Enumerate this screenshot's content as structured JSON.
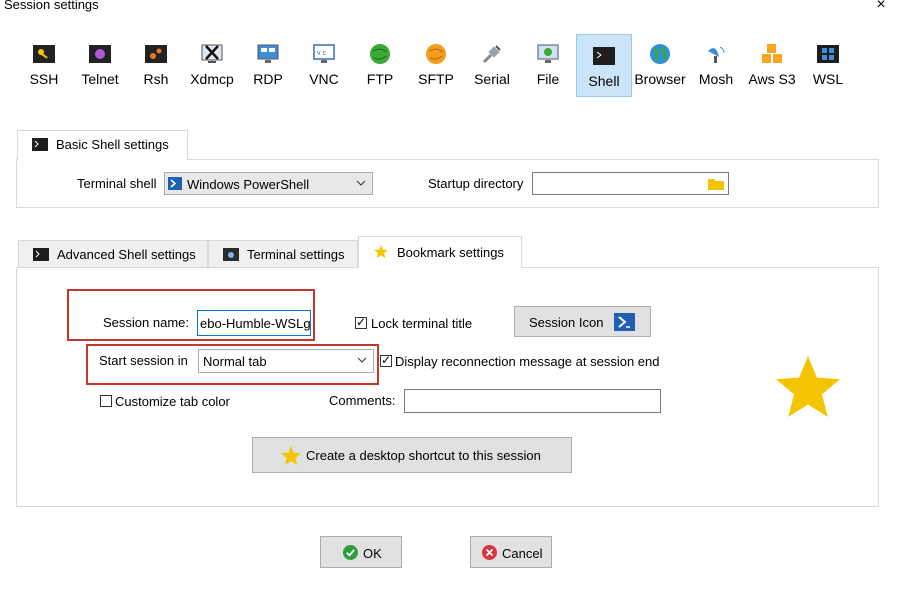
{
  "window": {
    "title": "Session settings",
    "close_glyph": "×"
  },
  "session_types": [
    {
      "label": "SSH",
      "icon": "key-icon"
    },
    {
      "label": "Telnet",
      "icon": "telnet-icon"
    },
    {
      "label": "Rsh",
      "icon": "gears-icon"
    },
    {
      "label": "Xdmcp",
      "icon": "x-icon"
    },
    {
      "label": "RDP",
      "icon": "monitor-icon"
    },
    {
      "label": "VNC",
      "icon": "vnc-icon"
    },
    {
      "label": "FTP",
      "icon": "globe-green-icon"
    },
    {
      "label": "SFTP",
      "icon": "globe-orange-icon"
    },
    {
      "label": "Serial",
      "icon": "plug-icon"
    },
    {
      "label": "File",
      "icon": "monitor-file-icon"
    },
    {
      "label": "Shell",
      "icon": "terminal-icon",
      "selected": true
    },
    {
      "label": "Browser",
      "icon": "earth-icon"
    },
    {
      "label": "Mosh",
      "icon": "satellite-icon"
    },
    {
      "label": "Aws S3",
      "icon": "cubes-icon"
    },
    {
      "label": "WSL",
      "icon": "windows-icon"
    }
  ],
  "basic": {
    "tab_label": "Basic Shell settings",
    "terminal_shell_label": "Terminal shell",
    "terminal_shell_value": "Windows PowerShell",
    "startup_directory_label": "Startup directory",
    "startup_directory_value": ""
  },
  "lower_tabs": {
    "advanced": "Advanced Shell settings",
    "terminal": "Terminal settings",
    "bookmark": "Bookmark settings"
  },
  "bookmark": {
    "session_name_label": "Session name:",
    "session_name_value": "ebo-Humble-WSLg",
    "lock_title_label": "Lock terminal title",
    "lock_title_checked": true,
    "session_icon_label": "Session Icon",
    "start_session_label": "Start session in",
    "start_session_value": "Normal tab",
    "reconnect_label": "Display reconnection message at session end",
    "reconnect_checked": true,
    "tab_color_label": "Customize tab color",
    "tab_color_checked": false,
    "comments_label": "Comments:",
    "comments_value": "",
    "shortcut_label": "Create a desktop shortcut to this session"
  },
  "footer": {
    "ok_label": "OK",
    "cancel_label": "Cancel"
  },
  "colors": {
    "highlight": "#c0392b",
    "selected_bg": "#cce4f7",
    "star": "#f5c400"
  }
}
